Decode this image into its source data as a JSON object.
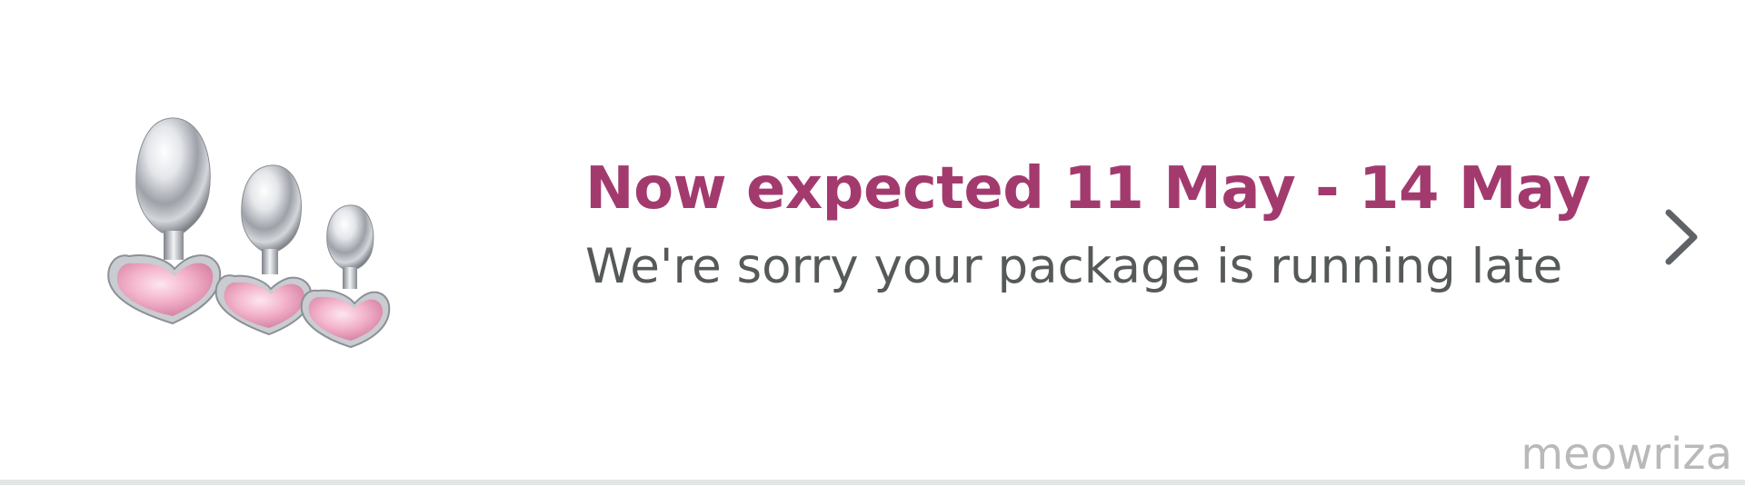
{
  "delivery_card": {
    "product_image_name": "heart-jewel-plug-set",
    "headline": "Now expected 11 May - 14 May",
    "subtext": "We're sorry your package is running late",
    "chevron_icon": "chevron-right-icon"
  },
  "watermark": "meowriza",
  "colors": {
    "headline": "#A33A6E",
    "subtext": "#565959",
    "chevron": "#5F6368",
    "watermark": "#B9B9B9",
    "divider": "#E3E6E6",
    "jewel": "#F1A9C5"
  }
}
